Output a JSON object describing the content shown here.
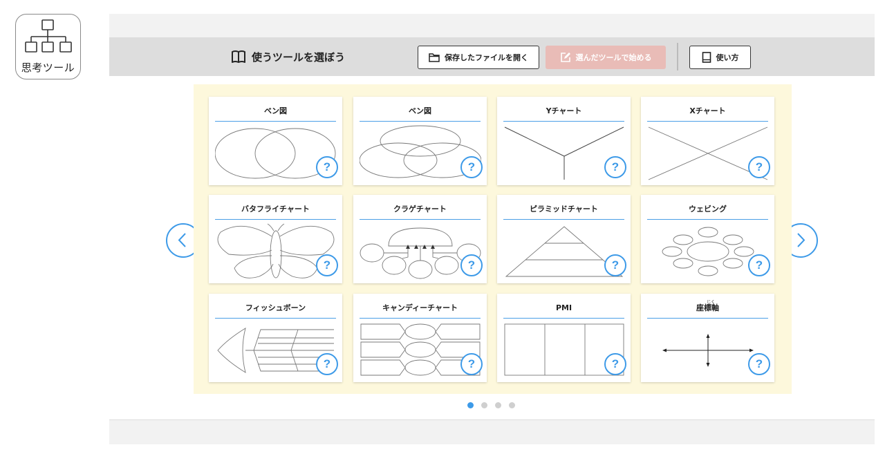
{
  "app": {
    "icon_label": "思考ツール",
    "icon_name": "hierarchy-diagram-icon"
  },
  "toolbar": {
    "title": "使うツールを選ぼう",
    "title_icon": "open-book-icon",
    "open_file_label": "保存したファイルを開く",
    "open_file_icon": "folder-icon",
    "start_label": "選んだツールで始める",
    "start_icon": "edit-icon",
    "start_enabled": false,
    "help_label": "使い方",
    "help_icon": "notebook-icon"
  },
  "tools": [
    {
      "title": "ベン図",
      "diagram": "venn-2"
    },
    {
      "title": "ベン図",
      "diagram": "venn-3"
    },
    {
      "title": "Yチャート",
      "diagram": "y-chart"
    },
    {
      "title": "Xチャート",
      "diagram": "x-chart"
    },
    {
      "title": "バタフライチャート",
      "diagram": "butterfly"
    },
    {
      "title": "クラゲチャート",
      "diagram": "jellyfish"
    },
    {
      "title": "ピラミッドチャート",
      "diagram": "pyramid"
    },
    {
      "title": "ウェビング",
      "diagram": "webbing"
    },
    {
      "title": "フィッシュボーン",
      "diagram": "fishbone"
    },
    {
      "title": "キャンディーチャート",
      "diagram": "candy"
    },
    {
      "title": "PMI",
      "diagram": "pmi"
    },
    {
      "title": "座標軸",
      "ruby": "じく",
      "diagram": "coordinate-axes"
    }
  ],
  "help_button_label": "?",
  "pagination": {
    "pages": 4,
    "current": 1
  },
  "colors": {
    "accent": "#3d9ae8",
    "panel_bg": "#fdf8dc",
    "toolbar_bg": "#dddddd",
    "disabled_button": "#e9bcb7"
  }
}
